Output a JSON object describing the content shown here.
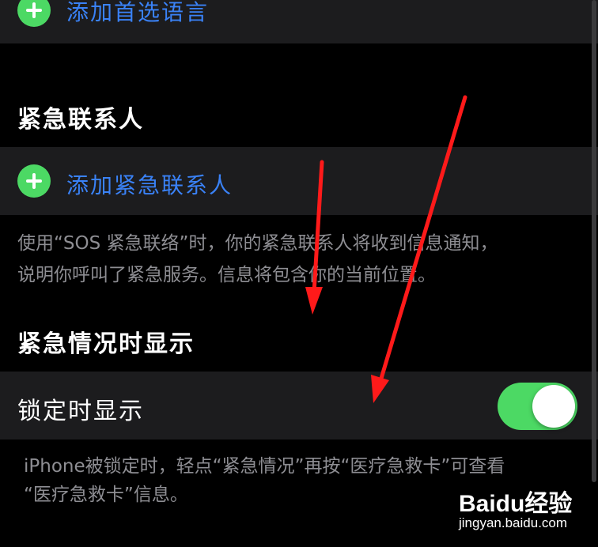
{
  "language": {
    "add_preferred_language": "添加首选语言"
  },
  "emergency_contacts": {
    "title": "紧急联系人",
    "add_contact_label": "添加紧急联系人",
    "footnote_line1": "使用“SOS 紧急联络”时，你的紧急联系人将收到信息通知，",
    "footnote_line2": "说明你呼叫了紧急服务。信息将包含你的当前位置。"
  },
  "emergency_display": {
    "title": "紧急情况时显示",
    "show_when_locked_label": "锁定时显示",
    "show_when_locked_on": true,
    "footnote_line1": "iPhone被锁定时，轻点“紧急情况”再按“医疗急救卡”可查看",
    "footnote_line2": "“医疗急救卡”信息。"
  },
  "watermark": {
    "brand": "Baidu经验",
    "url": "jingyan.baidu.com"
  },
  "colors": {
    "accent_blue": "#3a82f7",
    "ios_green": "#4cd964",
    "arrow_red": "#ff1a1a",
    "cell_bg": "#1c1c1e"
  }
}
